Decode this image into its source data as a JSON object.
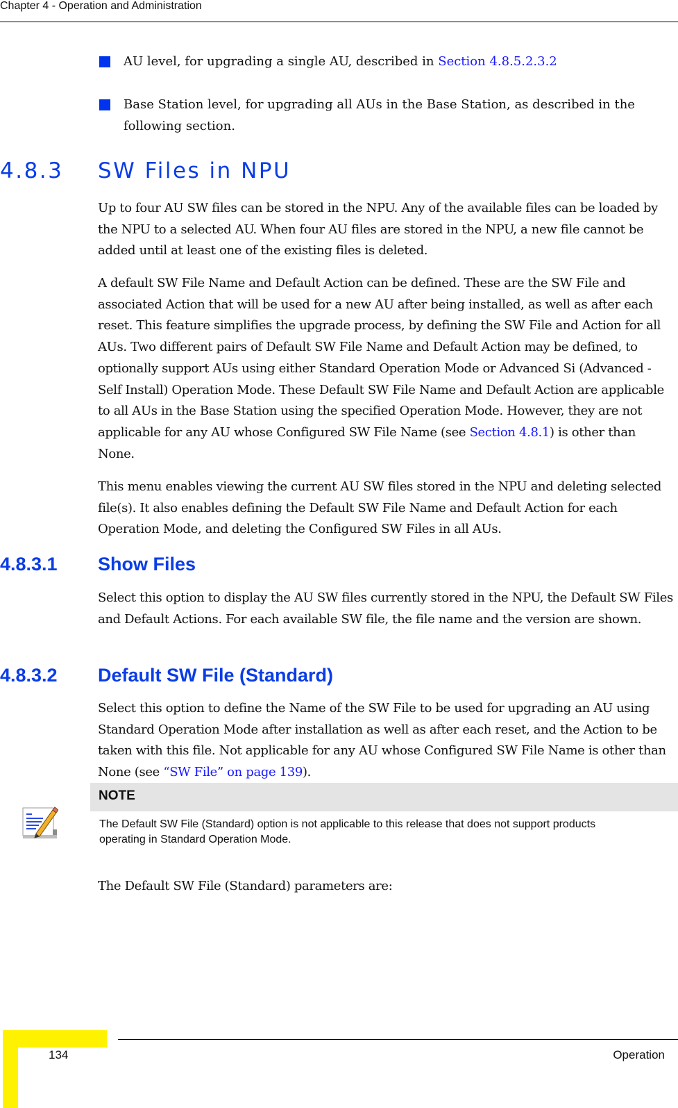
{
  "header": {
    "running_title": "Chapter 4 - Operation and Administration"
  },
  "bullets": [
    {
      "text": "AU level, for upgrading a single AU, described in ",
      "link": "Section 4.8.5.2.3.2",
      "after": ""
    },
    {
      "text": "Base Station level, for upgrading all AUs in the Base Station, as described in the following section.",
      "link": "",
      "after": ""
    }
  ],
  "section": {
    "number": "4.8.3",
    "title": "SW Files in NPU",
    "paragraphs": [
      {
        "text": "Up to four AU SW files can be stored in the NPU. Any of the available files can be loaded by the NPU to a selected AU. When four AU files are stored in the NPU, a new file cannot be added until at least one of the existing files is deleted."
      },
      {
        "before": "A default SW File Name and Default Action can be defined. These are the SW File and associated Action that will be used for a new AU after being installed, as well as after each reset. This feature simplifies the upgrade process, by defining the SW File and Action for all AUs. Two different pairs of Default SW File Name and Default Action may be defined, to optionally support AUs using either Standard Operation Mode or Advanced Si (Advanced - Self Install) Operation Mode. These Default SW File Name and Default Action are applicable to all AUs in the Base Station using the specified Operation Mode. However, they are not applicable for any AU whose Configured SW File Name (see ",
        "link": "Section 4.8.1",
        "after": ") is other than None."
      },
      {
        "text": "This menu enables viewing the current AU SW files stored in the NPU and deleting selected file(s). It also enables defining the Default SW File Name and Default Action for each Operation Mode, and deleting the Configured SW Files in all AUs."
      }
    ]
  },
  "subsections": [
    {
      "number": "4.8.3.1",
      "title": "Show Files",
      "body": "Select this option to display the AU SW files currently stored in the NPU, the Default SW Files and Default Actions. For each available SW file, the file name and the version are shown."
    },
    {
      "number": "4.8.3.2",
      "title": "Default SW File (Standard)",
      "body_before": "Select this option to define the Name of the SW File to be used for upgrading an AU using Standard Operation Mode after installation as well as after each reset, and the Action to be taken with this file. Not applicable for any AU whose Configured SW File Name is other than None (see ",
      "body_link": "“SW File” on page 139",
      "body_after": ")."
    }
  ],
  "note": {
    "title": "NOTE",
    "icon": "note-pencil-icon",
    "text": "The Default SW File (Standard) option is not applicable to this release that does not support products operating in Standard Operation Mode."
  },
  "closing_paragraph": "The Default SW File (Standard) parameters are:",
  "footer": {
    "page_number": "134",
    "section_label": "Operation",
    "tab_color": "#fff200"
  },
  "colors": {
    "heading_blue": "#0a3de6",
    "link_blue": "#1a1aff",
    "bullet_blue": "#0033ee",
    "note_band": "#e4e4e4"
  }
}
